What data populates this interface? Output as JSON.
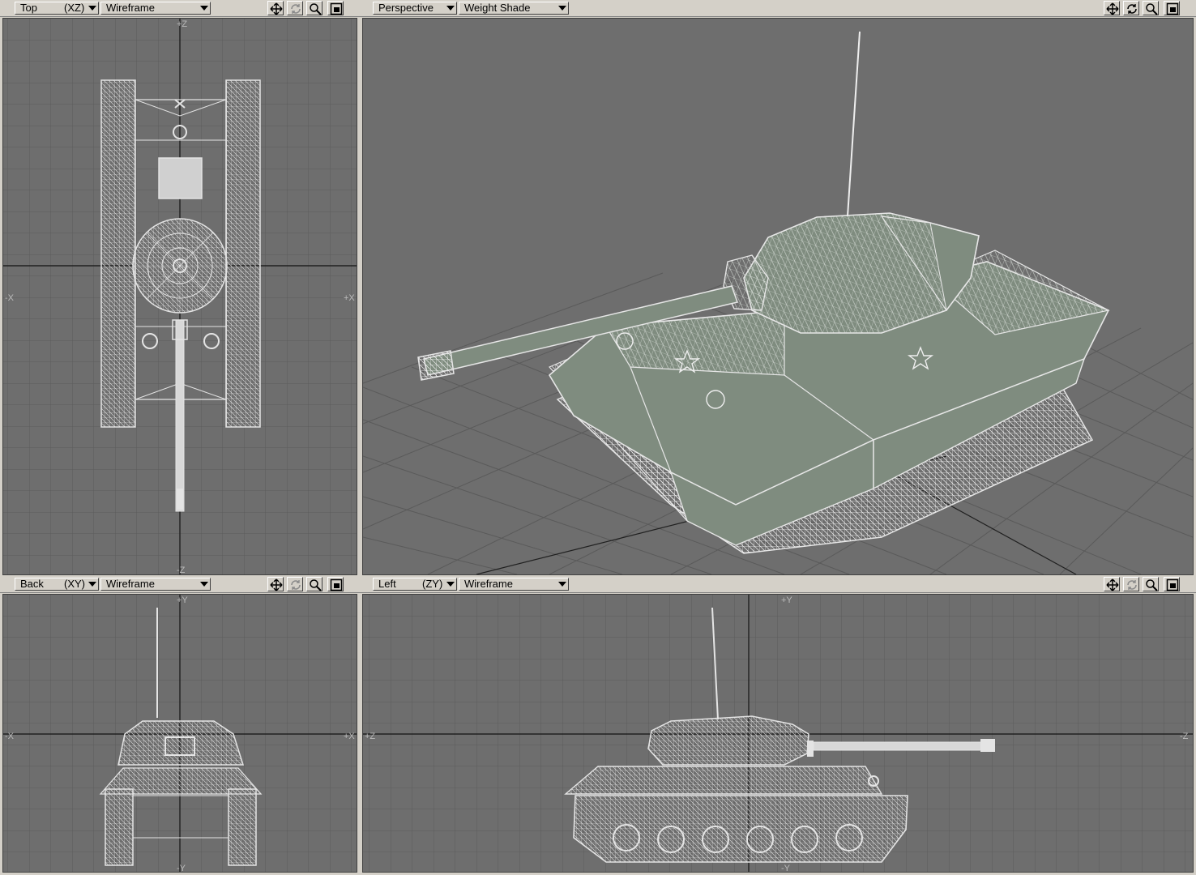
{
  "viewports": {
    "top": {
      "view_label": "Top",
      "axis_label": "(XZ)",
      "mode_label": "Wireframe",
      "axis_ticks": {
        "top": "+Z",
        "bottom": "-Z",
        "left": "-X",
        "right": "+X"
      }
    },
    "persp": {
      "view_label": "Perspective",
      "axis_label": "",
      "mode_label": "Weight Shade"
    },
    "back": {
      "view_label": "Back",
      "axis_label": "(XY)",
      "mode_label": "Wireframe",
      "axis_ticks": {
        "top": "+Y",
        "bottom": "-Y",
        "left": "-X",
        "right": "+X"
      }
    },
    "left": {
      "view_label": "Left",
      "axis_label": "(ZY)",
      "mode_label": "Wireframe",
      "axis_ticks": {
        "top": "+Y",
        "bottom": "-Y",
        "left": "+Z",
        "right": "-Z"
      }
    }
  },
  "toolbar_icons": [
    "move-view-icon",
    "rotate-view-icon",
    "zoom-view-icon",
    "maximize-view-icon"
  ],
  "colors": {
    "viewport_bg": "#6e6e6e",
    "grid_line": "#5c5c5c",
    "axis_line": "#202020",
    "wireframe": "#e4e4e4",
    "shaded_mesh": "#7f8c7f",
    "chrome": "#d4d0c8"
  }
}
